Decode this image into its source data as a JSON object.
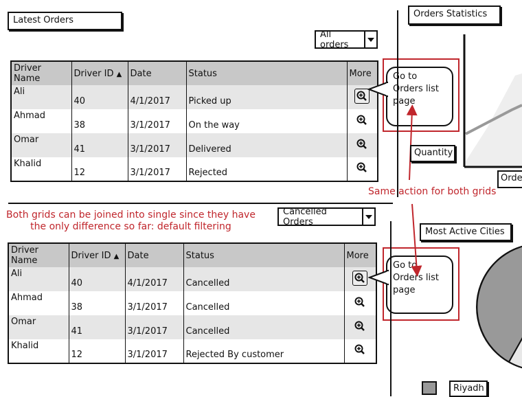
{
  "latest": {
    "title": "Latest Orders",
    "filter": "All orders",
    "columns": [
      "Driver Name",
      "Driver ID",
      "Date",
      "Status",
      "More"
    ],
    "rows": [
      {
        "name": "Ali",
        "id": "40",
        "date": "4/1/2017",
        "status": "Picked up"
      },
      {
        "name": "Ahmad",
        "id": "38",
        "date": "3/1/2017",
        "status": "On the way"
      },
      {
        "name": "Omar",
        "id": "41",
        "date": "3/1/2017",
        "status": "Delivered"
      },
      {
        "name": "Khalid",
        "id": "12",
        "date": "3/1/2017",
        "status": "Rejected"
      }
    ]
  },
  "cancelled": {
    "filter": "Cancelled Orders",
    "columns": [
      "Driver Name",
      "Driver ID",
      "Date",
      "Status",
      "More"
    ],
    "rows": [
      {
        "name": "Ali",
        "id": "40",
        "date": "4/1/2017",
        "status": "Cancelled"
      },
      {
        "name": "Ahmad",
        "id": "38",
        "date": "3/1/2017",
        "status": "Cancelled"
      },
      {
        "name": "Omar",
        "id": "41",
        "date": "3/1/2017",
        "status": "Cancelled"
      },
      {
        "name": "Khalid",
        "id": "12",
        "date": "3/1/2017",
        "status": "Rejected By customer"
      }
    ]
  },
  "callouts": {
    "top": "Go to Orders list page",
    "bottom": "Go to Orders list page"
  },
  "notes": {
    "same_action": "Same action for both grids",
    "join_grids": "Both grids can be joined into single since they have the only difference so far: default filtering"
  },
  "right_panel": {
    "stats_title": "Orders Statistics",
    "quantity_label": "Quantity",
    "orders_label_partial": "Orde",
    "cities_title": "Most Active Cities",
    "legend_city": "Riyadh"
  },
  "colors": {
    "annotation_red": "#c0262c",
    "header_gray": "#c8c8c8",
    "alt_row_gray": "#e6e6e6"
  }
}
